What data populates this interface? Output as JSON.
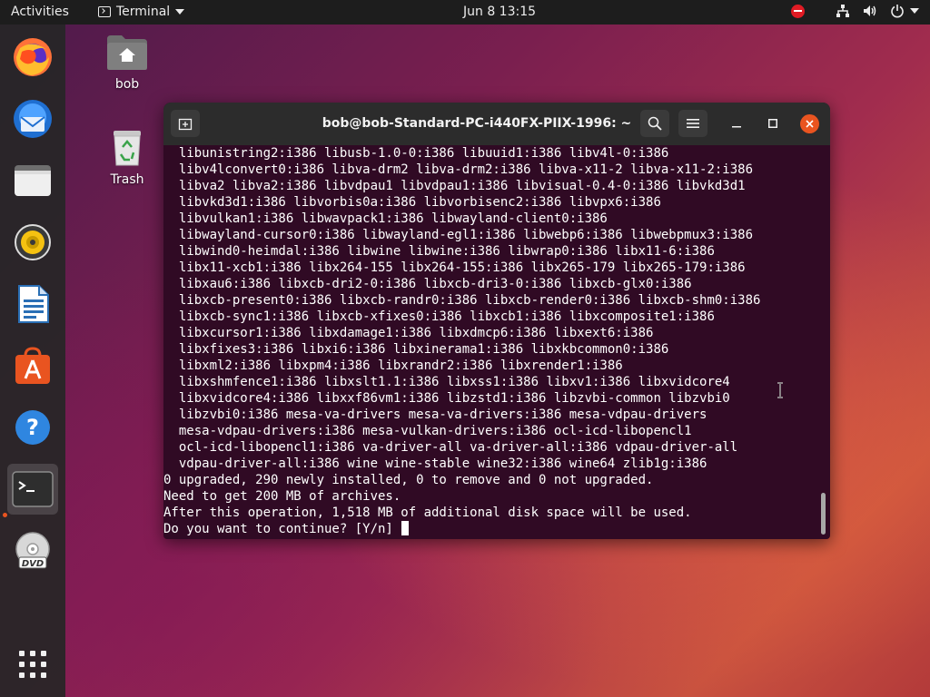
{
  "topbar": {
    "activities": "Activities",
    "app_name": "Terminal",
    "clock": "Jun 8  13:15"
  },
  "dock": {
    "items": [
      "firefox-icon",
      "thunderbird-icon",
      "files-icon",
      "rhythmbox-icon",
      "libreoffice-writer-icon",
      "ubuntu-software-icon",
      "help-icon",
      "terminal-icon",
      "dvd-icon",
      "show-applications-icon"
    ]
  },
  "desktop": {
    "home_label": "bob",
    "trash_label": "Trash"
  },
  "terminal": {
    "title": "bob@bob-Standard-PC-i440FX-PIIX-1996: ~",
    "lines": [
      "  libunistring2:i386 libusb-1.0-0:i386 libuuid1:i386 libv4l-0:i386",
      "  libv4lconvert0:i386 libva-drm2 libva-drm2:i386 libva-x11-2 libva-x11-2:i386",
      "  libva2 libva2:i386 libvdpau1 libvdpau1:i386 libvisual-0.4-0:i386 libvkd3d1",
      "  libvkd3d1:i386 libvorbis0a:i386 libvorbisenc2:i386 libvpx6:i386",
      "  libvulkan1:i386 libwavpack1:i386 libwayland-client0:i386",
      "  libwayland-cursor0:i386 libwayland-egl1:i386 libwebp6:i386 libwebpmux3:i386",
      "  libwind0-heimdal:i386 libwine libwine:i386 libwrap0:i386 libx11-6:i386",
      "  libx11-xcb1:i386 libx264-155 libx264-155:i386 libx265-179 libx265-179:i386",
      "  libxau6:i386 libxcb-dri2-0:i386 libxcb-dri3-0:i386 libxcb-glx0:i386",
      "  libxcb-present0:i386 libxcb-randr0:i386 libxcb-render0:i386 libxcb-shm0:i386",
      "  libxcb-sync1:i386 libxcb-xfixes0:i386 libxcb1:i386 libxcomposite1:i386",
      "  libxcursor1:i386 libxdamage1:i386 libxdmcp6:i386 libxext6:i386",
      "  libxfixes3:i386 libxi6:i386 libxinerama1:i386 libxkbcommon0:i386",
      "  libxml2:i386 libxpm4:i386 libxrandr2:i386 libxrender1:i386",
      "  libxshmfence1:i386 libxslt1.1:i386 libxss1:i386 libxv1:i386 libxvidcore4",
      "  libxvidcore4:i386 libxxf86vm1:i386 libzstd1:i386 libzvbi-common libzvbi0",
      "  libzvbi0:i386 mesa-va-drivers mesa-va-drivers:i386 mesa-vdpau-drivers",
      "  mesa-vdpau-drivers:i386 mesa-vulkan-drivers:i386 ocl-icd-libopencl1",
      "  ocl-icd-libopencl1:i386 va-driver-all va-driver-all:i386 vdpau-driver-all",
      "  vdpau-driver-all:i386 wine wine-stable wine32:i386 wine64 zlib1g:i386",
      "0 upgraded, 290 newly installed, 0 to remove and 0 not upgraded.",
      "Need to get 200 MB of archives.",
      "After this operation, 1,518 MB of additional disk space will be used."
    ],
    "prompt": "Do you want to continue? [Y/n] "
  },
  "colors": {
    "terminal_bg": "#300a24",
    "header_bg": "#2c2c2c",
    "accent_orange": "#e95420",
    "topbar_bg": "#1d1d1d"
  }
}
